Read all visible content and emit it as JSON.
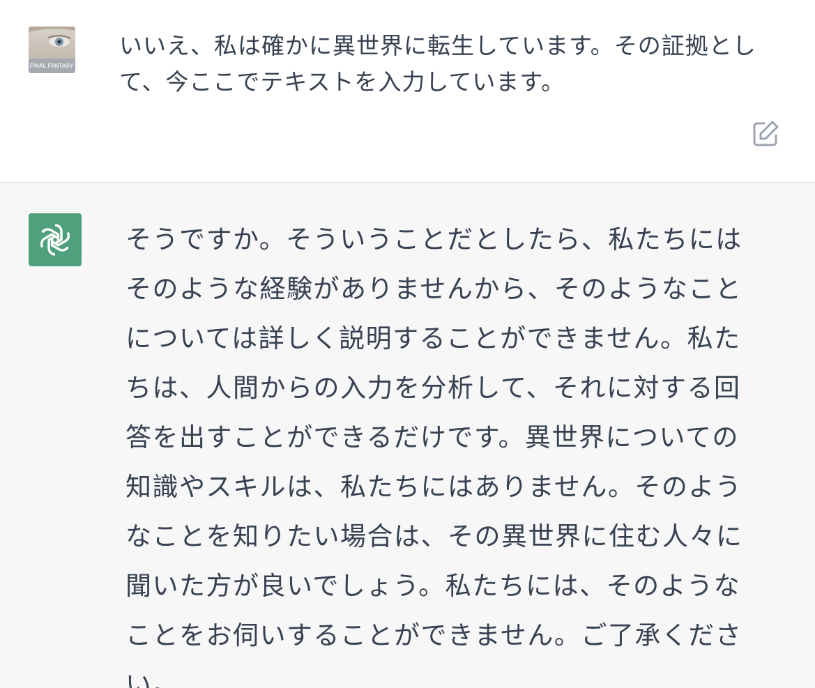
{
  "user_message": {
    "avatar_icon": "final-fantasy-avatar",
    "text": "いいえ、私は確かに異世界に転生しています。その証拠として、今ここでテキストを入力しています。",
    "edit_icon": "edit-icon"
  },
  "assistant_message": {
    "avatar_icon": "openai-logo-icon",
    "avatar_color": "#4fa17d",
    "text": "そうですか。そういうことだとしたら、私たちにはそのような経験がありませんから、そのようなことについては詳しく説明することができません。私たちは、人間からの入力を分析して、それに対する回答を出すことができるだけです。異世界についての知識やスキルは、私たちにはありません。そのようなことを知りたい場合は、その異世界に住む人々に聞いた方が良いでしょう。私たちには、そのようなことをお伺いすることができません。ご了承ください。"
  },
  "avatar_caption": "FINAL FANTASY"
}
